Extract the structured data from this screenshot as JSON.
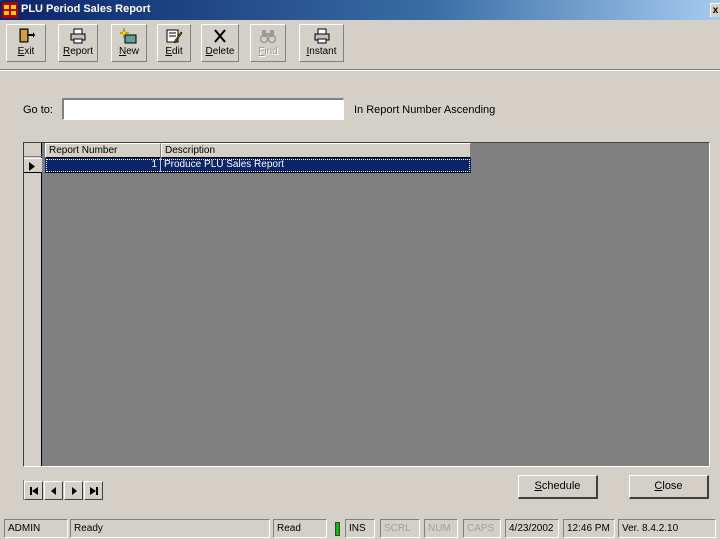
{
  "window": {
    "title": "PLU Period Sales Report",
    "close_glyph": "x"
  },
  "toolbar": {
    "buttons": [
      {
        "label": "Exit",
        "icon": "exit-door-icon",
        "enabled": true
      },
      {
        "label": "Report",
        "icon": "printer-icon",
        "enabled": true
      },
      {
        "label": "New",
        "icon": "new-sparkle-icon",
        "enabled": true
      },
      {
        "label": "Edit",
        "icon": "edit-pencil-icon",
        "enabled": true
      },
      {
        "label": "Delete",
        "icon": "delete-x-icon",
        "enabled": true
      },
      {
        "label": "Find",
        "icon": "binoculars-icon",
        "enabled": false
      },
      {
        "label": "Instant",
        "icon": "printer-icon",
        "enabled": true
      }
    ]
  },
  "goto": {
    "label": "Go to:",
    "value": "",
    "sort_text": "In Report Number Ascending"
  },
  "grid": {
    "columns": [
      "Report Number",
      "Description"
    ],
    "rows": [
      {
        "report_number": "1",
        "description": "Produce PLU Sales Report",
        "selected": true
      }
    ]
  },
  "actions": {
    "schedule_label": "Schedule",
    "close_label": "Close"
  },
  "status": {
    "user": "ADMIN",
    "state": "Ready",
    "mode": "Read",
    "ins": "INS",
    "scrl": "SCRL",
    "num": "NUM",
    "caps": "CAPS",
    "date": "4/23/2002",
    "time": "12:46 PM",
    "version": "Ver. 8.4.2.10"
  },
  "colors": {
    "window_bg": "#d4d0c8",
    "title_gradient_start": "#0a246a",
    "selection": "#0a246a",
    "led": "#00c000"
  }
}
